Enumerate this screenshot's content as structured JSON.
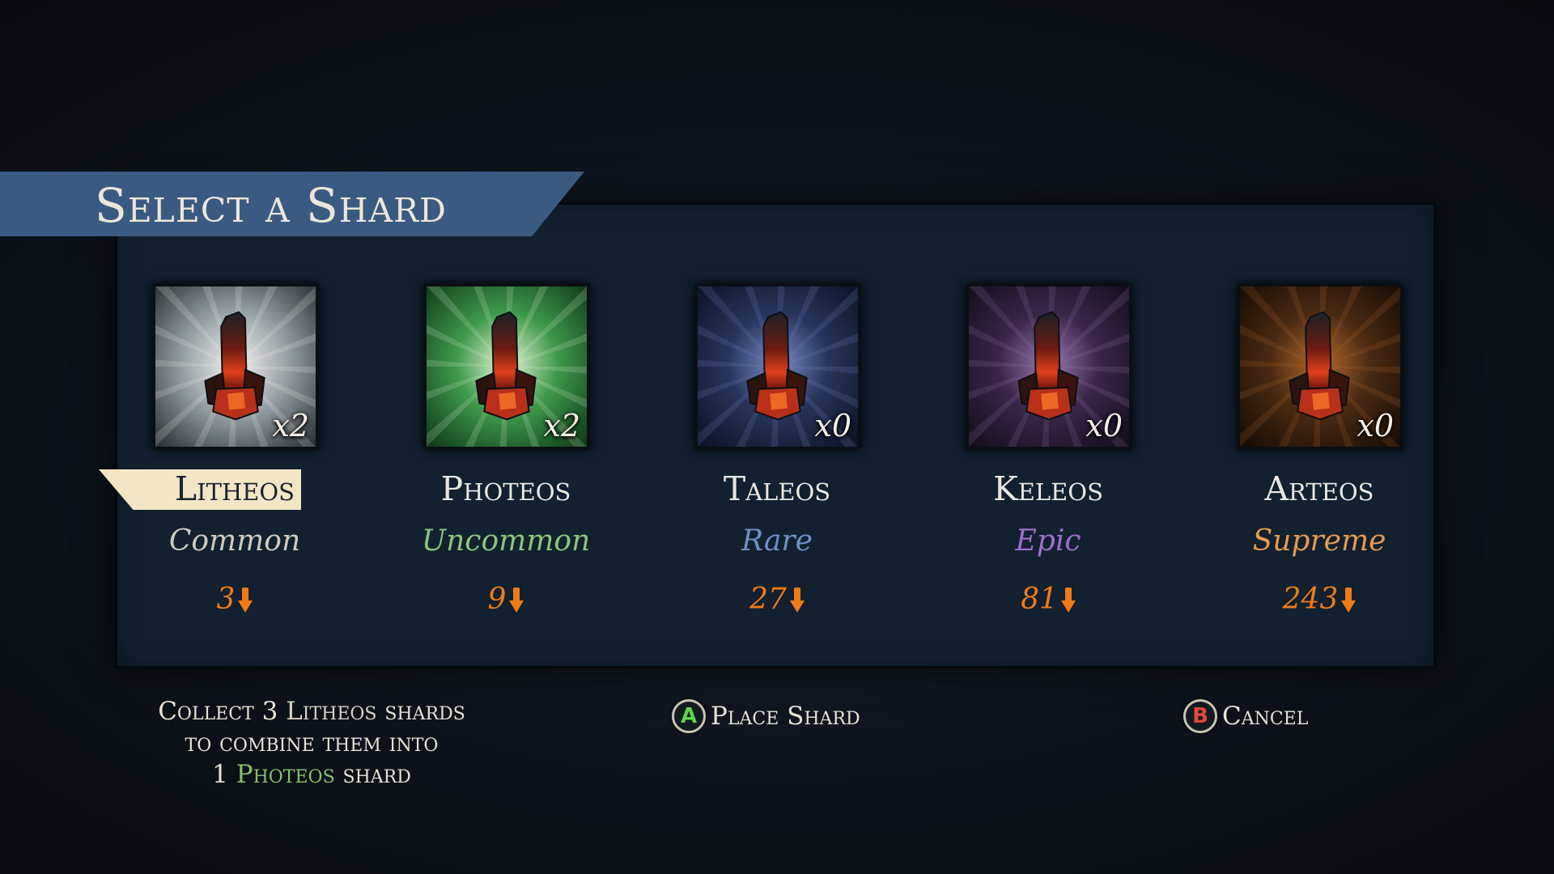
{
  "title": "Select a Shard",
  "shards": [
    {
      "name": "Litheos",
      "rarity": "Common",
      "count": "x2",
      "value": "3",
      "selected": true,
      "rarity_color": "#cfcabe",
      "bg_colors": [
        "#f4f4f0",
        "#9aa4a8",
        "#2a3236"
      ]
    },
    {
      "name": "Photeos",
      "rarity": "Uncommon",
      "count": "x2",
      "value": "9",
      "selected": false,
      "rarity_color": "#8cc47a",
      "bg_colors": [
        "#e6f5d8",
        "#3f9a4a",
        "#0f3a1a"
      ]
    },
    {
      "name": "Taleos",
      "rarity": "Rare",
      "count": "x0",
      "value": "27",
      "selected": false,
      "rarity_color": "#6f8fc4",
      "bg_colors": [
        "#7b8cc8",
        "#27345c",
        "#0d1224"
      ]
    },
    {
      "name": "Keleos",
      "rarity": "Epic",
      "count": "x0",
      "value": "81",
      "selected": false,
      "rarity_color": "#9d6fc9",
      "bg_colors": [
        "#9a7ab4",
        "#3a2648",
        "#140e1c"
      ]
    },
    {
      "name": "Arteos",
      "rarity": "Supreme",
      "count": "x0",
      "value": "243",
      "selected": false,
      "rarity_color": "#e59a4e",
      "bg_colors": [
        "#b8682a",
        "#4a2a12",
        "#160c06"
      ]
    }
  ],
  "hint": {
    "line1_prefix": "Collect 3",
    "line1_item": "Litheos",
    "line1_suffix": "shards",
    "line2": "to combine them into",
    "line3_prefix": "1",
    "line3_item": "Photeos",
    "line3_suffix": "shard"
  },
  "actions": {
    "place": {
      "button": "A",
      "label": "Place Shard",
      "color": "#5fd34a"
    },
    "cancel": {
      "button": "B",
      "label": "Cancel",
      "color": "#e0473e"
    }
  },
  "value_icon": "orange-down-arrow-icon",
  "shard_icon": "crystal-shard-icon"
}
